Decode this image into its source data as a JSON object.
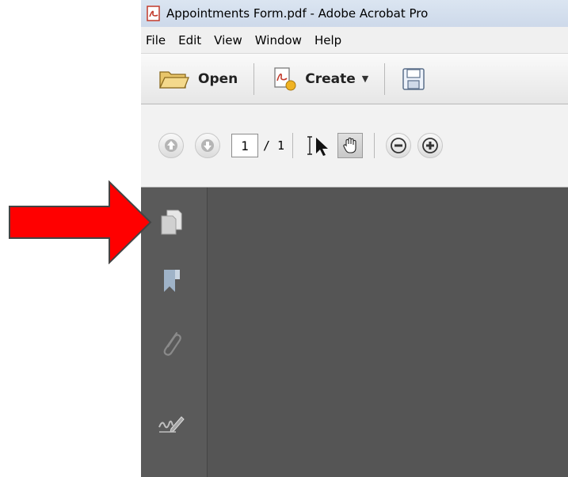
{
  "window": {
    "title": "Appointments Form.pdf - Adobe Acrobat Pro"
  },
  "menu": [
    "File",
    "Edit",
    "View",
    "Window",
    "Help"
  ],
  "toolbar": {
    "open_label": "Open",
    "create_label": "Create"
  },
  "navigation": {
    "current_page": "1",
    "total_pages": "/ 1"
  },
  "side_panel": {
    "icons": [
      "pages-icon",
      "bookmark-icon",
      "attachment-icon",
      "signature-icon"
    ]
  },
  "annotation": {
    "arrow_color": "#ff0000"
  },
  "colors": {
    "nav_pane": "#5a5a5a",
    "document_area": "#555555",
    "title_bar": "#d6e1ef"
  }
}
